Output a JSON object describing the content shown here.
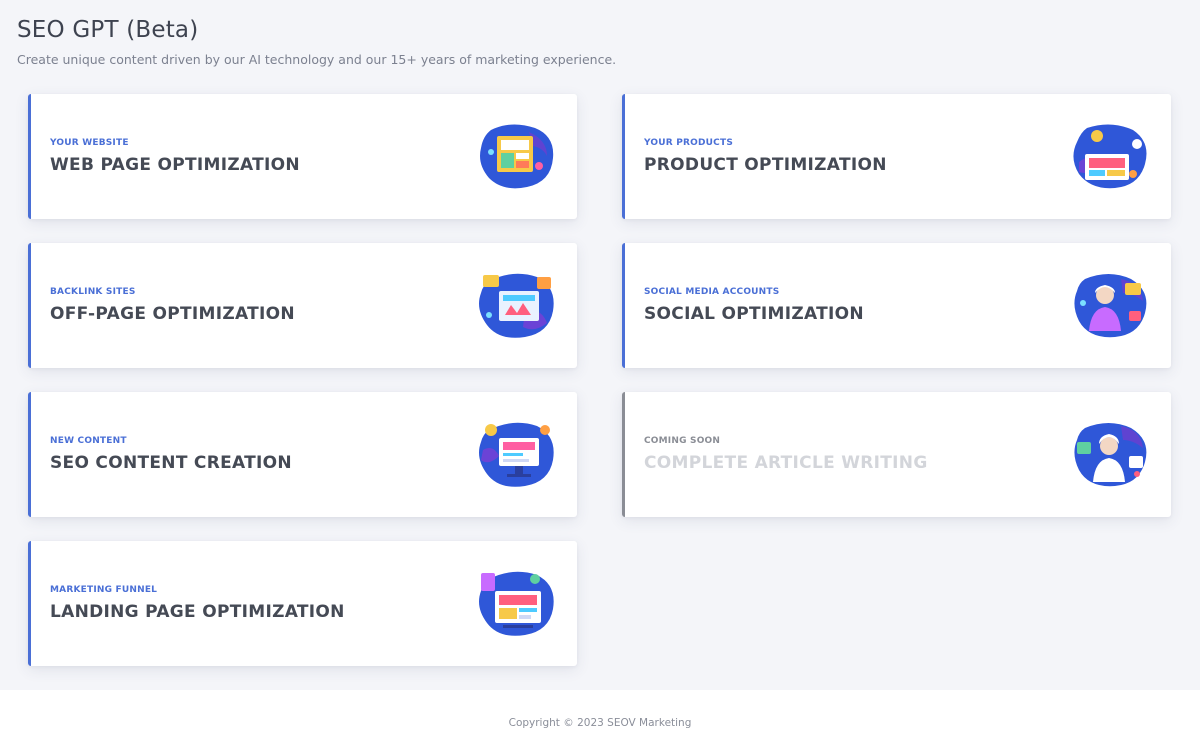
{
  "header": {
    "title": "SEO GPT (Beta)",
    "subtitle": "Create unique content driven by our AI technology and our 15+ years of marketing experience."
  },
  "cards": [
    {
      "eyebrow": "YOUR WEBSITE",
      "title": "WEB PAGE OPTIMIZATION",
      "illustration": "website-illustration-icon",
      "enabled": true
    },
    {
      "eyebrow": "YOUR PRODUCTS",
      "title": "PRODUCT OPTIMIZATION",
      "illustration": "products-illustration-icon",
      "enabled": true
    },
    {
      "eyebrow": "BACKLINK SITES",
      "title": "OFF-PAGE OPTIMIZATION",
      "illustration": "backlink-illustration-icon",
      "enabled": true
    },
    {
      "eyebrow": "SOCIAL MEDIA ACCOUNTS",
      "title": "SOCIAL OPTIMIZATION",
      "illustration": "social-illustration-icon",
      "enabled": true
    },
    {
      "eyebrow": "NEW CONTENT",
      "title": "SEO CONTENT CREATION",
      "illustration": "content-illustration-icon",
      "enabled": true
    },
    {
      "eyebrow": "COMING SOON",
      "title": "COMPLETE ARTICLE WRITING",
      "illustration": "article-illustration-icon",
      "enabled": false
    },
    {
      "eyebrow": "MARKETING FUNNEL",
      "title": "LANDING PAGE OPTIMIZATION",
      "illustration": "landing-illustration-icon",
      "enabled": true
    }
  ],
  "footer": {
    "copyright": "Copyright © 2023 SEOV Marketing"
  },
  "colors": {
    "accent": "#4a6fd6",
    "disabled": "#8a8d95",
    "background": "#f4f5f9"
  }
}
